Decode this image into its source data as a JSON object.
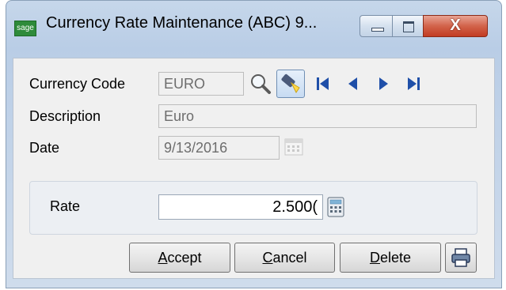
{
  "window": {
    "title": "Currency Rate Maintenance (ABC) 9...",
    "app_icon_text": "sage",
    "close_glyph": "X"
  },
  "form": {
    "currency_code_label": "Currency Code",
    "currency_code_value": "EURO",
    "description_label": "Description",
    "description_value": "Euro",
    "date_label": "Date",
    "date_value": "9/13/2016",
    "rate_label": "Rate",
    "rate_value": "2.500("
  },
  "buttons": {
    "accept_first": "A",
    "accept_rest": "ccept",
    "cancel_first": "C",
    "cancel_rest": "ancel",
    "delete_first": "D",
    "delete_rest": "elete"
  },
  "icons": {
    "lookup": "magnifier-icon",
    "browse": "flashlight-icon",
    "first": "first-record-icon",
    "prev": "previous-record-icon",
    "next": "next-record-icon",
    "last": "last-record-icon",
    "calendar": "calendar-icon",
    "calculator": "calculator-icon",
    "print": "printer-icon"
  },
  "colors": {
    "nav_arrows": "#1f4fa8",
    "close_button": "#c23b22",
    "sage_green": "#2e8b3a"
  }
}
